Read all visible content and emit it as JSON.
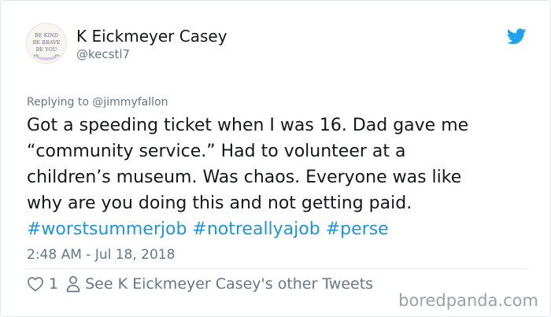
{
  "user": {
    "display_name": "K Eickmeyer Casey",
    "handle": "@kecstl7",
    "avatar_text": [
      "BE KIND",
      "BE BRAVE",
      "BE YOU"
    ]
  },
  "tweet": {
    "replying_prefix": "Replying to ",
    "replying_to": "@jimmyfallon",
    "lines": [
      "Got a speeding ticket when I was 16. Dad gave me",
      "“community service.” Had to volunteer at a",
      "children’s museum. Was chaos. Everyone was like",
      "why are you doing this and not getting paid."
    ],
    "hashtags": [
      "#worstsummerjob",
      "#notreallyajob",
      "#perse"
    ],
    "timestamp": "2:48 AM - Jul 18, 2018"
  },
  "actions": {
    "like_icon": "heart-icon",
    "like_count": "1",
    "profile_icon": "person-icon",
    "other_tweets_label": "See K Eickmeyer Casey's other Tweets"
  },
  "watermark": "boredpanda.com",
  "colors": {
    "link": "#1b95e0",
    "text": "#14171a",
    "secondary": "#657786",
    "border": "#e1e8ed",
    "watermark": "#9aa0a6"
  },
  "icons": {
    "brand": "twitter-bird-icon"
  }
}
